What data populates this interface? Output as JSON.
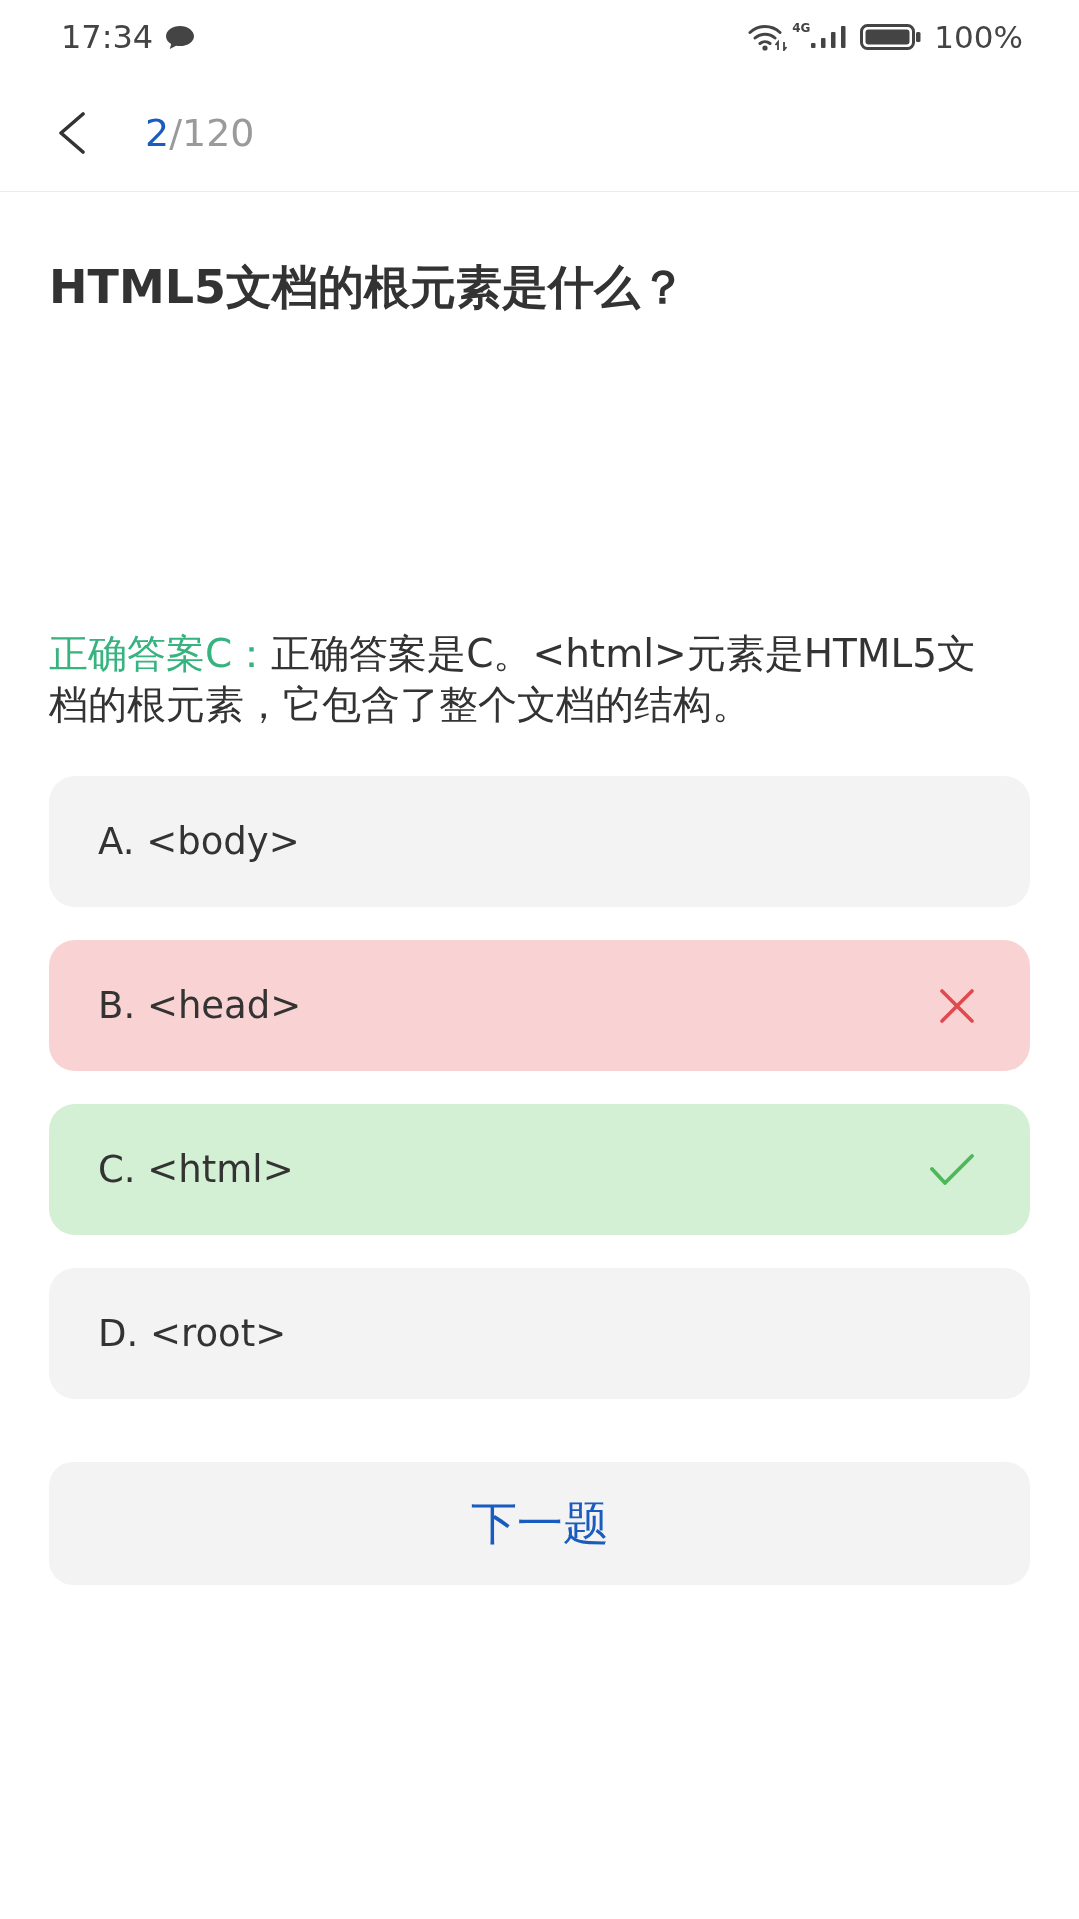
{
  "status_bar": {
    "time": "17:34",
    "network": "4G",
    "battery": "100%"
  },
  "header": {
    "current": "2",
    "total": "/120"
  },
  "question": {
    "text": "HTML5文档的根元素是什么？"
  },
  "answer": {
    "label": "正确答案C：",
    "explanation": "正确答案是C。<html>元素是HTML5文档的根元素，它包含了整个文档的结构。"
  },
  "options": [
    {
      "text": "A. <body>",
      "kind": "plain"
    },
    {
      "text": "B. <head>",
      "kind": "wrong"
    },
    {
      "text": "C. <html>",
      "kind": "correct"
    },
    {
      "text": "D. <root>",
      "kind": "plain"
    }
  ],
  "next_button": {
    "label": "下一题"
  }
}
